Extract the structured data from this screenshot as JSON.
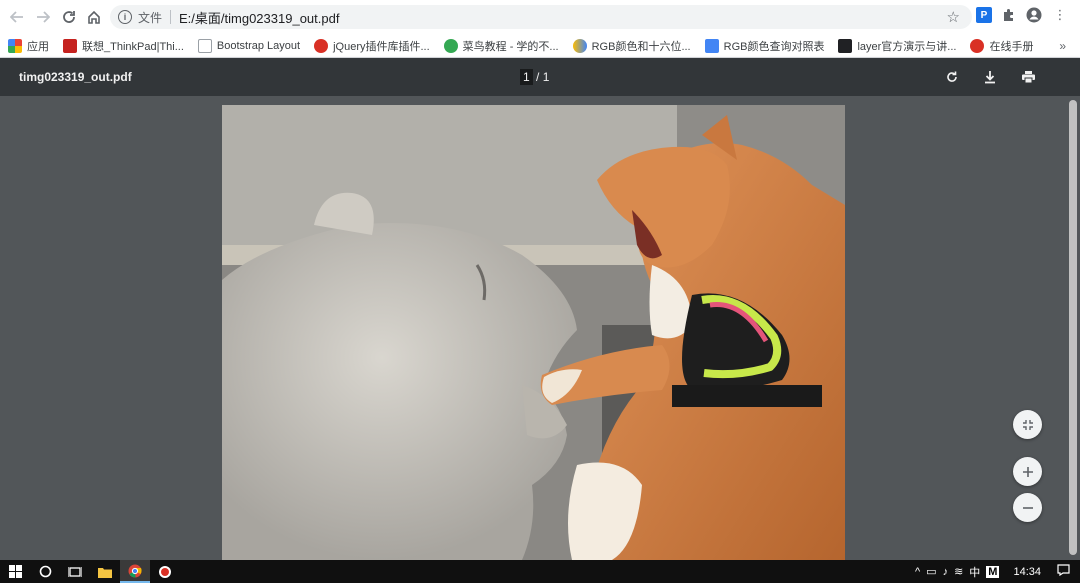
{
  "browser": {
    "scheme_label": "文件",
    "url": "E:/桌面/timg023319_out.pdf"
  },
  "bookmarks": [
    {
      "label": "应用",
      "color": "#ea4335"
    },
    {
      "label": "联想_ThinkPad|Thi...",
      "color": "#c5221f"
    },
    {
      "label": "Bootstrap Layout",
      "color": "#9aa0a6"
    },
    {
      "label": "jQuery插件库插件...",
      "color": "#d93025"
    },
    {
      "label": "菜鸟教程 - 学的不...",
      "color": "#34a853"
    },
    {
      "label": "RGB颜色和十六位...",
      "color": "#fbbc04"
    },
    {
      "label": "RGB颜色查询对照表",
      "color": "#4285f4"
    },
    {
      "label": "layer官方演示与讲...",
      "color": "#202124"
    },
    {
      "label": "在线手册",
      "color": "#d93025"
    }
  ],
  "bookmarks_more": "»",
  "pdf": {
    "title": "timg023319_out.pdf",
    "current_page": "1",
    "page_separator": "/ 1"
  },
  "taskbar": {
    "ime": "中",
    "m_badge": "M",
    "time": "14:34"
  }
}
